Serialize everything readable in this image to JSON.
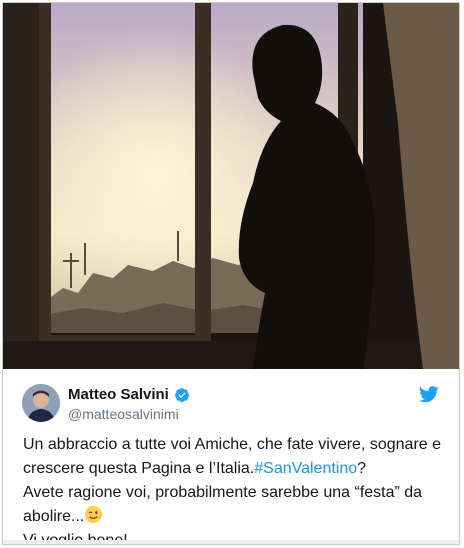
{
  "tweet": {
    "author_name": "Matteo Salvini",
    "author_handle": "@matteosalvinimi",
    "verified": true,
    "line1_text": "Un abbraccio a tutte voi Amiche, che fate vivere, sognare e crescere questa Pagina e l’Italia.",
    "hashtag": "#SanValentino",
    "line1_end": "?",
    "line2_text": "Avete ragione voi, probabilmente sarebbe una “festa” da abolire...",
    "line3_text": "Vi voglio bene!"
  },
  "icons": {
    "verified": "verified-badge-icon",
    "brand": "twitter-bird-icon",
    "emoji": "winking-face-emoji"
  },
  "colors": {
    "brand": "#1da1f2",
    "hashtag": "#1b95e0",
    "text": "#14171a",
    "secondary": "#657786"
  }
}
